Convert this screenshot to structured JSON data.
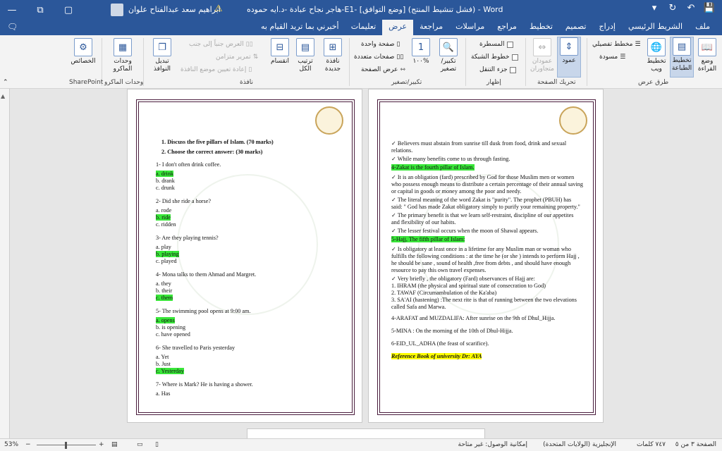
{
  "titlebar": {
    "doc_title": "هاجر نجاح عبادة -د.ايه حموده-E1- [وضع التوافق] (فشل تنشيط المنتج) - Word",
    "user_name": "ابراهيم سعد عبدالفتاح علوان",
    "win_min": "—",
    "win_max": "▢",
    "win_close": "✕",
    "win_restore": "⧉"
  },
  "qat": {
    "save": "💾",
    "undo": "↶",
    "redo": "↻",
    "more": "▾"
  },
  "tabs": [
    "ملف",
    "الشريط الرئيسي",
    "إدراج",
    "تصميم",
    "تخطيط",
    "مراجع",
    "مراسلات",
    "مراجعة",
    "عرض",
    "تعليمات"
  ],
  "active_tab": "عرض",
  "tellme": "أخبرني بما تريد القيام به",
  "ribbon": {
    "views": {
      "read": "وضع القراءة",
      "print": "تخطيط الطباعة",
      "web": "تخطيط ويب",
      "outline": "مخطط تفصيلي",
      "draft": "مسودة",
      "label": "طرق عرض"
    },
    "movement": {
      "vertical": "عمود",
      "side": "عمودان متجاوران",
      "label": "تحريك الصفحة"
    },
    "show": {
      "ruler": "المسطرة",
      "grid": "خطوط الشبكة",
      "nav": "جزء التنقل",
      "label": "إظهار"
    },
    "zoom": {
      "zoom": "تكبير/تصغير",
      "pct": "١٠٠%",
      "one": "صفحة واحدة",
      "multi": "صفحات متعددة",
      "width": "عرض الصفحة",
      "label": "تكبير/تصغير"
    },
    "window": {
      "new": "نافذة جديدة",
      "arrange": "ترتيب الكل",
      "split": "انقسام",
      "side": "العرض جنباً إلى جنب",
      "sync": "تمرير متزامن",
      "reset": "إعادة تعيين موضع النافذة",
      "switch": "تبديل النوافذ",
      "label": "نافذة"
    },
    "macros": {
      "macros": "وحدات الماكرو",
      "label": "وحدات الماكرو"
    },
    "sp": {
      "props": "الخصائص",
      "label": "SharePoint"
    }
  },
  "left_page": {
    "q1": "1.  Discuss the five pillars of Islam. (70 marks)",
    "q2": "2.  Choose the correct answer:  (30 marks)",
    "items": [
      {
        "q": "1-  I don't often drink coffee.",
        "a": "a.  drink",
        "b": "b.  drank",
        "c": "c.  drunk"
      },
      {
        "q": "2-  Did she ride a horse?",
        "a": "a.  rode",
        "b": "b.  ride",
        "c": "c.  ridden"
      },
      {
        "q": "3-  Are they playing tennis?",
        "a": "a.  play",
        "b": "b.  playing",
        "c": "c.  played"
      },
      {
        "q": "4-  Mona talks to them Ahmad and Margret.",
        "a": "a.  they",
        "b": "b.  their",
        "c": "c.  them"
      },
      {
        "q": "5-  The swimming pool opens at 9:00 am.",
        "a": "a.  opens",
        "b": "b.  is opening",
        "c": "c.  have opened"
      },
      {
        "q": "6-  She travelled to Paris yesterday",
        "a": "a.  Yet",
        "b": "b.  Just",
        "c": "c.  Yesterday"
      },
      {
        "q": "7-  Where is Mark? He is having a shower.",
        "a": "a.  Has"
      }
    ]
  },
  "right_page": {
    "l1": "✓   Believers must abstain from sunrise till dusk from food, drink and sexual relations.",
    "l2": "✓   While many benefits come to us through fasting.",
    "h_zakat": "4-Zakat is the fourth pillar of Islam.",
    "l3": "✓   It is an obligation (fard) prescribed by God for those Muslim men or women who possess enough means to distribute a certain percentage of their annual saving or capital in goods or money among the poor and needy.",
    "l4": "✓   The literal meaning of the word Zakat is \"purity\". The prophet (PBUH) has said: \" God has made Zakat obligatory simply to purify your remaining property.\"",
    "l5": "✓   The primary benefit is that we learn self-restraint, discipline of our appetites and flexibility of our habits.",
    "l6": "✓   The lesser festival occurs when the moon of Shawal appears.",
    "h_hajj": "5-Hajj, The fifth pillar of Islam:",
    "l7": "✓   Is obligatory at least once in a lifetime for any Muslim man or woman who fulfills the following conditions : at the time he (or she ) intends to perform Hajj , he should be sane , sound of health ,free from debts , and should have enough resource to pay this own travel expenses.",
    "l8": "✓   Very briefly , the obligatory (Fard)  observances  of Hajj are:",
    "n1": "1. IHRAM (the physical and spiritual state of consecration to God)",
    "n2": "2. TAWAF (Circumambulation  of the Ka'aba)",
    "n3": "3. SA'AI (hastening) :The next rite is that of running between the two elevations called Safa and Marwa.",
    "n4": "4-ARAFAT and MUZDALIFA: After sunrise on the 9th of Dhul_Hijja.",
    "n5": "5-MINA : On the morning of the 10th of Dhul-Hijja.",
    "n6": "6-EID_UL_ADHA (the feast of scarifice).",
    "ref": "Reference Book of university Dr: AYA"
  },
  "status": {
    "page": "الصفحة ٣ من ٥",
    "words": "٧٤٧ كلمات",
    "lang": "الإنجليزية (الولايات المتحدة)",
    "access": "إمكانية الوصول: غير متاحة",
    "zoom": "53%"
  },
  "colors": {
    "brand": "#2b579a",
    "highlight_green": "#39e639",
    "highlight_yellow": "#ffff00",
    "frame": "#4a1d3d"
  }
}
